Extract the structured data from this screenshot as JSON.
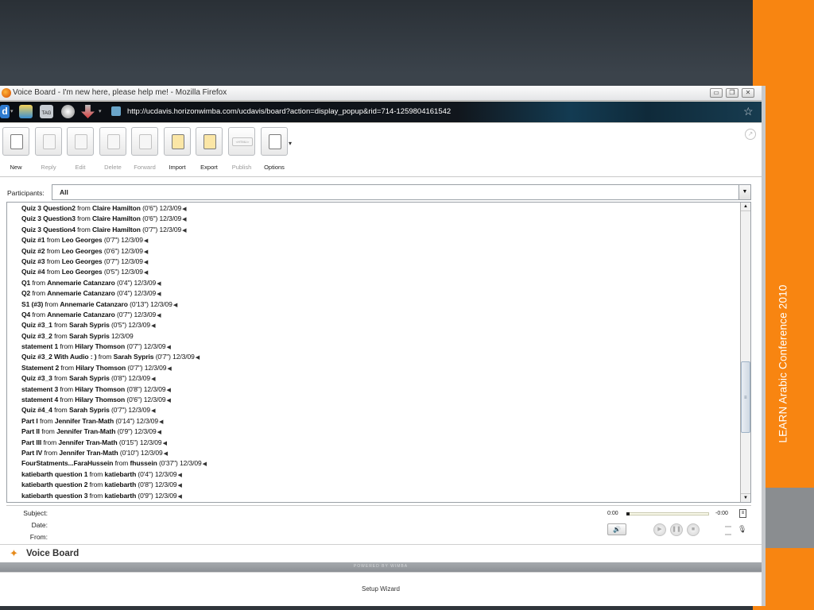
{
  "slide": {
    "side_text": "LEARN Arabic Conference 2010",
    "accent": "#f88511"
  },
  "browser": {
    "title": "Voice Board - I'm new here, please help me! - Mozilla Firefox",
    "url": "http://ucdavis.horizonwimba.com/ucdavis/board?action=display_popup&rid=714-1259804161542",
    "nav_first": "d",
    "nav_tag": "TAG"
  },
  "toolbar": {
    "new": "New",
    "reply": "Reply",
    "edit": "Edit",
    "delete": "Delete",
    "forward": "Forward",
    "import": "Import",
    "export": "Export",
    "publish": "Publish",
    "options": "Options",
    "html_tag": "<HTML/>"
  },
  "participants": {
    "label": "Participants:",
    "value": "All"
  },
  "messages": [
    {
      "title": "Quiz 3 Question2",
      "author": "Claire Hamilton",
      "meta": "(0'6\") 12/3/09",
      "audio": true
    },
    {
      "title": "Quiz 3 Question3",
      "author": "Claire Hamilton",
      "meta": "(0'6\") 12/3/09",
      "audio": true
    },
    {
      "title": "Quiz 3 Question4",
      "author": "Claire Hamilton",
      "meta": "(0'7\") 12/3/09",
      "audio": true
    },
    {
      "title": "Quiz #1",
      "author": "Leo Georges",
      "meta": "(0'7\") 12/3/09",
      "audio": true
    },
    {
      "title": "Quiz #2",
      "author": "Leo Georges",
      "meta": "(0'6\") 12/3/09",
      "audio": true
    },
    {
      "title": "Quiz #3",
      "author": "Leo Georges",
      "meta": "(0'7\") 12/3/09",
      "audio": true
    },
    {
      "title": "Quiz #4",
      "author": "Leo Georges",
      "meta": "(0'5\") 12/3/09",
      "audio": true
    },
    {
      "title": "Q1",
      "author": "Annemarie Catanzaro",
      "meta": "(0'4\") 12/3/09",
      "audio": true
    },
    {
      "title": "Q2",
      "author": "Annemarie Catanzaro",
      "meta": "(0'4\") 12/3/09",
      "audio": true
    },
    {
      "title": "S1 (#3)",
      "author": "Annemarie Catanzaro",
      "meta": "(0'13\") 12/3/09",
      "audio": true
    },
    {
      "title": "Q4",
      "author": "Annemarie Catanzaro",
      "meta": "(0'7\") 12/3/09",
      "audio": true
    },
    {
      "title": "Quiz #3_1",
      "author": "Sarah Sypris",
      "meta": "(0'5\") 12/3/09",
      "audio": true
    },
    {
      "title": "Quiz #3_2",
      "author": "Sarah Sypris",
      "meta": "12/3/09",
      "audio": false
    },
    {
      "title": "statement 1",
      "author": "Hilary Thomson",
      "meta": "(0'7\") 12/3/09",
      "audio": true
    },
    {
      "title": "Quiz #3_2 With Audio : )",
      "author": "Sarah Sypris",
      "meta": "(0'7\") 12/3/09",
      "audio": true
    },
    {
      "title": "Statement 2",
      "author": "Hilary Thomson",
      "meta": "(0'7\") 12/3/09",
      "audio": true
    },
    {
      "title": "Quiz #3_3",
      "author": "Sarah Sypris",
      "meta": "(0'8\") 12/3/09",
      "audio": true
    },
    {
      "title": "statement 3",
      "author": "Hilary Thomson",
      "meta": "(0'8\") 12/3/09",
      "audio": true
    },
    {
      "title": "statement 4",
      "author": "Hilary Thomson",
      "meta": "(0'6\") 12/3/09",
      "audio": true
    },
    {
      "title": "Quiz #4_4",
      "author": "Sarah Sypris",
      "meta": "(0'7\") 12/3/09",
      "audio": true
    },
    {
      "title": "Part I",
      "author": "Jennifer Tran-Math",
      "meta": "(0'14\") 12/3/09",
      "audio": true
    },
    {
      "title": "Part II",
      "author": "Jennifer Tran-Math",
      "meta": "(0'9\") 12/3/09",
      "audio": true
    },
    {
      "title": "Part III",
      "author": "Jennifer Tran-Math",
      "meta": "(0'15\") 12/3/09",
      "audio": true
    },
    {
      "title": "Part IV",
      "author": "Jennifer Tran-Math",
      "meta": "(0'10\") 12/3/09",
      "audio": true
    },
    {
      "title": "FourStatments...FaraHussein",
      "author": "fhussein",
      "meta": "(0'37\") 12/3/09",
      "audio": true
    },
    {
      "title": "katiebarth question 1",
      "author": "katiebarth",
      "meta": "(0'4\") 12/3/09",
      "audio": true
    },
    {
      "title": "katiebarth question 2",
      "author": "katiebarth",
      "meta": "(0'8\") 12/3/09",
      "audio": true
    },
    {
      "title": "katiebarth question 3",
      "author": "katiebarth",
      "meta": "(0'9\") 12/3/09",
      "audio": true
    }
  ],
  "message_from": "from",
  "details": {
    "subject_label": "Subject:",
    "date_label": "Date:",
    "from_label": "From:"
  },
  "player": {
    "elapsed": "0:00",
    "remaining": "-0:00",
    "progress": 0
  },
  "app": {
    "name": "Voice Board",
    "powered_by": "POWERED BY WIMBA",
    "setup_wizard": "Setup Wizard"
  }
}
